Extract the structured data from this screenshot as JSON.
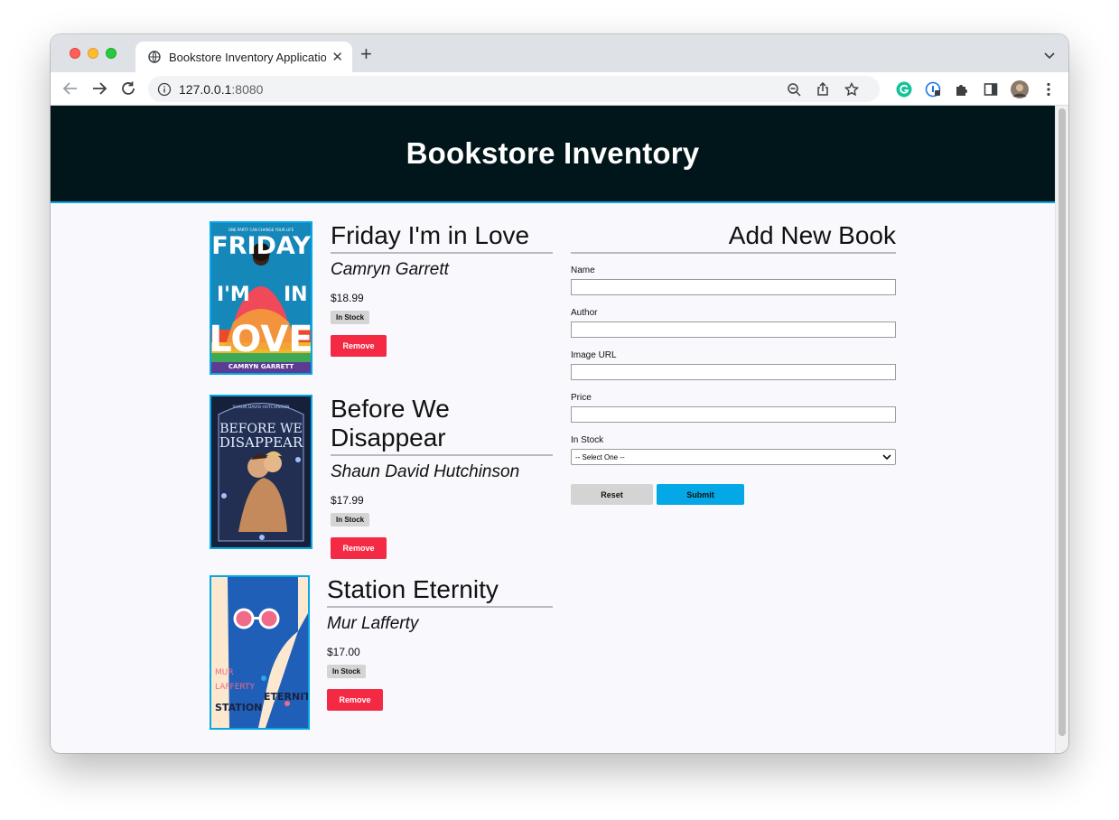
{
  "browser": {
    "tab_title": "Bookstore Inventory Applicatio",
    "new_tab_symbol": "+",
    "url_host": "127.0.0.1",
    "url_port": ":8080"
  },
  "page": {
    "title": "Bookstore Inventory"
  },
  "books": [
    {
      "title": "Friday I'm in Love",
      "author": "Camryn Garrett",
      "price": "$18.99",
      "stock": "In Stock",
      "remove_label": "Remove",
      "cover_text": {
        "tagline": "ONE PARTY CAN CHANGE YOUR LIFE",
        "line1": "FRIDAY",
        "line2": "I'M",
        "line3": "IN",
        "line4": "LOVE",
        "author": "CAMRYN GARRETT"
      }
    },
    {
      "title": "Before We Disappear",
      "author": "Shaun David Hutchinson",
      "price": "$17.99",
      "stock": "In Stock",
      "remove_label": "Remove",
      "cover_text": {
        "author": "SHAUN DAVID HUTCHINSON",
        "line1": "BEFORE WE",
        "line2": "DISAPPEAR"
      }
    },
    {
      "title": "Station Eternity",
      "author": "Mur Lafferty",
      "price": "$17.00",
      "stock": "In Stock",
      "remove_label": "Remove",
      "cover_text": {
        "author1": "MUR",
        "author2": "LAFFERTY",
        "title1": "STATION",
        "title2": "ETERNITY"
      }
    }
  ],
  "form": {
    "title": "Add New Book",
    "name_label": "Name",
    "author_label": "Author",
    "image_label": "Image URL",
    "price_label": "Price",
    "stock_label": "In Stock",
    "stock_selected": "-- Select One --",
    "reset_label": "Reset",
    "submit_label": "Submit"
  },
  "colors": {
    "header_bg": "#01161a",
    "accent": "#05a8e6",
    "remove": "#f42a44",
    "page_bg": "#f8f8fd"
  }
}
